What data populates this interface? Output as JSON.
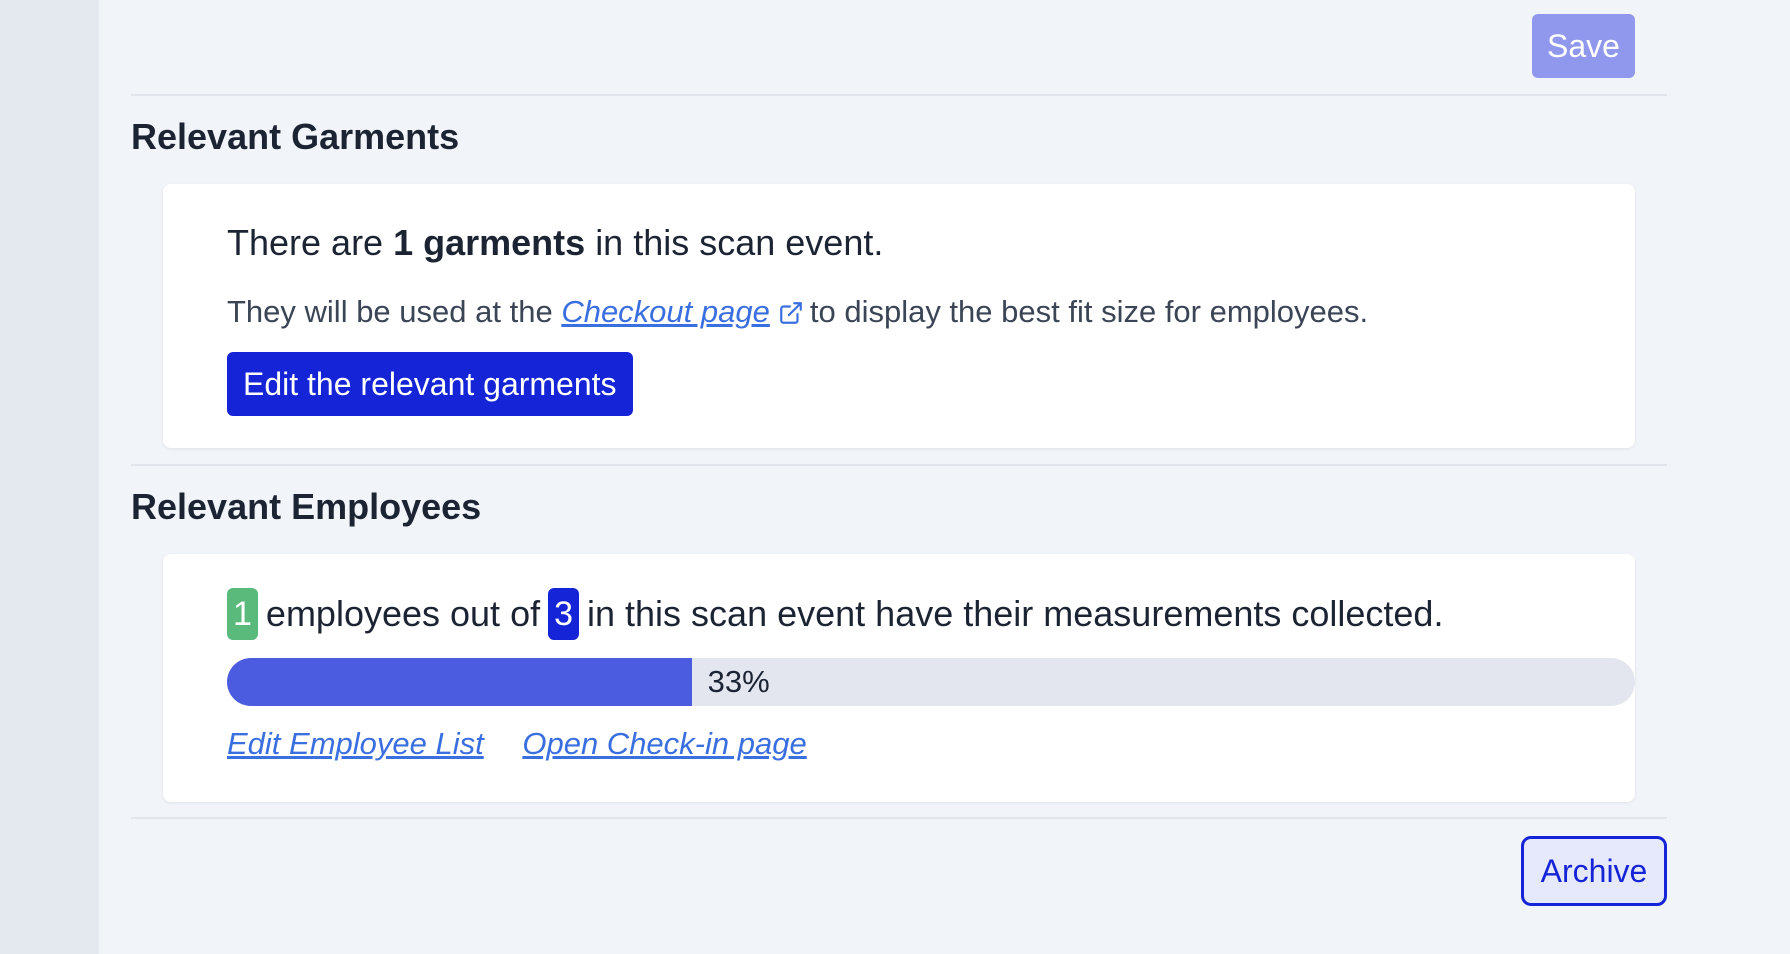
{
  "header": {
    "save_label": "Save"
  },
  "garments": {
    "title": "Relevant Garments",
    "text_prefix": "There are",
    "count_bold": "1 garments",
    "text_suffix": "in this scan event.",
    "usage_prefix": "They will be used at the",
    "checkout_link": "Checkout page",
    "usage_suffix": "to display the best fit size for employees.",
    "edit_button": "Edit the relevant garments"
  },
  "employees": {
    "title": "Relevant Employees",
    "collected_count": "1",
    "text_middle": "employees out of",
    "total_count": "3",
    "text_suffix": "in this scan event have their measurements collected.",
    "progress_fraction": 0.33,
    "progress_label": "33%",
    "edit_list_link": "Edit Employee List",
    "checkin_link": "Open Check-in page"
  },
  "footer": {
    "archive_label": "Archive"
  },
  "colors": {
    "primary": "#1424d6",
    "progress": "#4b5ce0",
    "success": "#5aba7b",
    "link": "#3a6fe0",
    "save_disabled": "#8f98ec"
  },
  "icons": {
    "external_link": "external-link-icon"
  }
}
